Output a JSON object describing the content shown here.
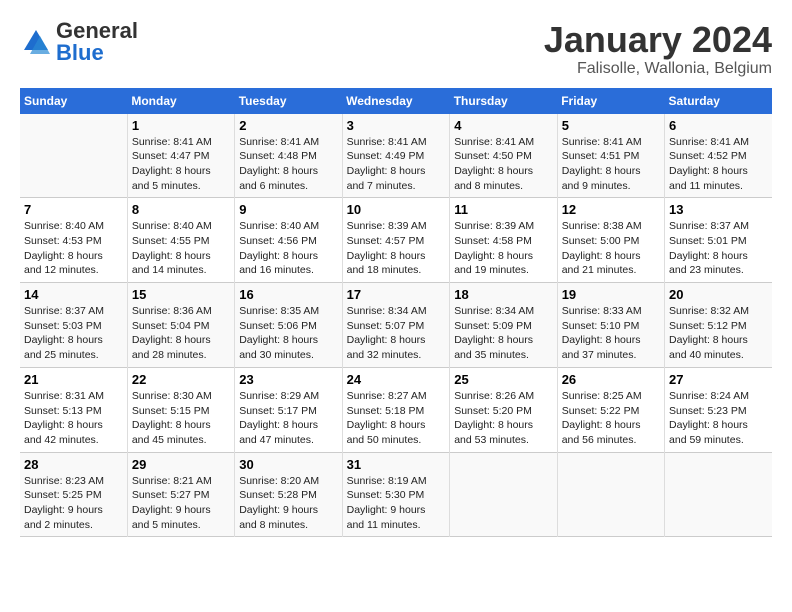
{
  "header": {
    "logo_general": "General",
    "logo_blue": "Blue",
    "month_title": "January 2024",
    "location": "Falisolle, Wallonia, Belgium"
  },
  "days_of_week": [
    "Sunday",
    "Monday",
    "Tuesday",
    "Wednesday",
    "Thursday",
    "Friday",
    "Saturday"
  ],
  "weeks": [
    [
      {
        "day": "",
        "info": ""
      },
      {
        "day": "1",
        "info": "Sunrise: 8:41 AM\nSunset: 4:47 PM\nDaylight: 8 hours\nand 5 minutes."
      },
      {
        "day": "2",
        "info": "Sunrise: 8:41 AM\nSunset: 4:48 PM\nDaylight: 8 hours\nand 6 minutes."
      },
      {
        "day": "3",
        "info": "Sunrise: 8:41 AM\nSunset: 4:49 PM\nDaylight: 8 hours\nand 7 minutes."
      },
      {
        "day": "4",
        "info": "Sunrise: 8:41 AM\nSunset: 4:50 PM\nDaylight: 8 hours\nand 8 minutes."
      },
      {
        "day": "5",
        "info": "Sunrise: 8:41 AM\nSunset: 4:51 PM\nDaylight: 8 hours\nand 9 minutes."
      },
      {
        "day": "6",
        "info": "Sunrise: 8:41 AM\nSunset: 4:52 PM\nDaylight: 8 hours\nand 11 minutes."
      }
    ],
    [
      {
        "day": "7",
        "info": "Sunrise: 8:40 AM\nSunset: 4:53 PM\nDaylight: 8 hours\nand 12 minutes."
      },
      {
        "day": "8",
        "info": "Sunrise: 8:40 AM\nSunset: 4:55 PM\nDaylight: 8 hours\nand 14 minutes."
      },
      {
        "day": "9",
        "info": "Sunrise: 8:40 AM\nSunset: 4:56 PM\nDaylight: 8 hours\nand 16 minutes."
      },
      {
        "day": "10",
        "info": "Sunrise: 8:39 AM\nSunset: 4:57 PM\nDaylight: 8 hours\nand 18 minutes."
      },
      {
        "day": "11",
        "info": "Sunrise: 8:39 AM\nSunset: 4:58 PM\nDaylight: 8 hours\nand 19 minutes."
      },
      {
        "day": "12",
        "info": "Sunrise: 8:38 AM\nSunset: 5:00 PM\nDaylight: 8 hours\nand 21 minutes."
      },
      {
        "day": "13",
        "info": "Sunrise: 8:37 AM\nSunset: 5:01 PM\nDaylight: 8 hours\nand 23 minutes."
      }
    ],
    [
      {
        "day": "14",
        "info": "Sunrise: 8:37 AM\nSunset: 5:03 PM\nDaylight: 8 hours\nand 25 minutes."
      },
      {
        "day": "15",
        "info": "Sunrise: 8:36 AM\nSunset: 5:04 PM\nDaylight: 8 hours\nand 28 minutes."
      },
      {
        "day": "16",
        "info": "Sunrise: 8:35 AM\nSunset: 5:06 PM\nDaylight: 8 hours\nand 30 minutes."
      },
      {
        "day": "17",
        "info": "Sunrise: 8:34 AM\nSunset: 5:07 PM\nDaylight: 8 hours\nand 32 minutes."
      },
      {
        "day": "18",
        "info": "Sunrise: 8:34 AM\nSunset: 5:09 PM\nDaylight: 8 hours\nand 35 minutes."
      },
      {
        "day": "19",
        "info": "Sunrise: 8:33 AM\nSunset: 5:10 PM\nDaylight: 8 hours\nand 37 minutes."
      },
      {
        "day": "20",
        "info": "Sunrise: 8:32 AM\nSunset: 5:12 PM\nDaylight: 8 hours\nand 40 minutes."
      }
    ],
    [
      {
        "day": "21",
        "info": "Sunrise: 8:31 AM\nSunset: 5:13 PM\nDaylight: 8 hours\nand 42 minutes."
      },
      {
        "day": "22",
        "info": "Sunrise: 8:30 AM\nSunset: 5:15 PM\nDaylight: 8 hours\nand 45 minutes."
      },
      {
        "day": "23",
        "info": "Sunrise: 8:29 AM\nSunset: 5:17 PM\nDaylight: 8 hours\nand 47 minutes."
      },
      {
        "day": "24",
        "info": "Sunrise: 8:27 AM\nSunset: 5:18 PM\nDaylight: 8 hours\nand 50 minutes."
      },
      {
        "day": "25",
        "info": "Sunrise: 8:26 AM\nSunset: 5:20 PM\nDaylight: 8 hours\nand 53 minutes."
      },
      {
        "day": "26",
        "info": "Sunrise: 8:25 AM\nSunset: 5:22 PM\nDaylight: 8 hours\nand 56 minutes."
      },
      {
        "day": "27",
        "info": "Sunrise: 8:24 AM\nSunset: 5:23 PM\nDaylight: 8 hours\nand 59 minutes."
      }
    ],
    [
      {
        "day": "28",
        "info": "Sunrise: 8:23 AM\nSunset: 5:25 PM\nDaylight: 9 hours\nand 2 minutes."
      },
      {
        "day": "29",
        "info": "Sunrise: 8:21 AM\nSunset: 5:27 PM\nDaylight: 9 hours\nand 5 minutes."
      },
      {
        "day": "30",
        "info": "Sunrise: 8:20 AM\nSunset: 5:28 PM\nDaylight: 9 hours\nand 8 minutes."
      },
      {
        "day": "31",
        "info": "Sunrise: 8:19 AM\nSunset: 5:30 PM\nDaylight: 9 hours\nand 11 minutes."
      },
      {
        "day": "",
        "info": ""
      },
      {
        "day": "",
        "info": ""
      },
      {
        "day": "",
        "info": ""
      }
    ]
  ]
}
